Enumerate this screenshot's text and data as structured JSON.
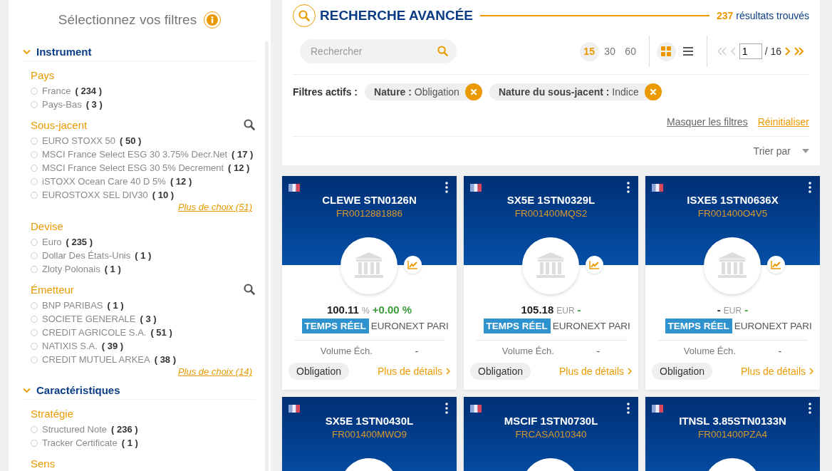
{
  "sidebar": {
    "title": "Sélectionnez vos filtres",
    "sections": [
      {
        "title": "Instrument",
        "expanded": true,
        "groups": [
          {
            "title": "Pays",
            "searchable": false,
            "options": [
              {
                "label": "France",
                "count": "( 234 )",
                "selected": false
              },
              {
                "label": "Pays-Bas",
                "count": "( 3 )",
                "selected": false
              }
            ]
          },
          {
            "title": "Sous-jacent",
            "searchable": true,
            "options": [
              {
                "label": "EURO STOXX 50",
                "count": "( 50 )",
                "selected": false
              },
              {
                "label": "MSCI France Select ESG 30 3.75% Decr.Net",
                "count": "( 17 )",
                "selected": false
              },
              {
                "label": "MSCI France Select ESG 30 5% Decrement",
                "count": "( 12 )",
                "selected": false
              },
              {
                "label": "iSTOXX Ocean Care 40 D 5%",
                "count": "( 12 )",
                "selected": false
              },
              {
                "label": "EUROSTOXX SEL DIV30",
                "count": "( 10 )",
                "selected": false
              }
            ],
            "more": "Plus de choix (51)"
          },
          {
            "title": "Devise",
            "searchable": false,
            "options": [
              {
                "label": "Euro",
                "count": "( 235 )",
                "selected": false
              },
              {
                "label": "Dollar Des États-Unis",
                "count": "( 1 )",
                "selected": false
              },
              {
                "label": "Zloty Polonais",
                "count": "( 1 )",
                "selected": false
              }
            ]
          },
          {
            "title": "Émetteur",
            "searchable": true,
            "options": [
              {
                "label": "BNP PARIBAS",
                "count": "( 1 )",
                "selected": false
              },
              {
                "label": "SOCIETE GENERALE",
                "count": "( 3 )",
                "selected": false
              },
              {
                "label": "CREDIT AGRICOLE S.A.",
                "count": "( 51 )",
                "selected": false
              },
              {
                "label": "NATIXIS S.A.",
                "count": "( 39 )",
                "selected": false
              },
              {
                "label": "CREDIT MUTUEL ARKEA",
                "count": "( 38 )",
                "selected": false
              }
            ],
            "more": "Plus de choix (14)"
          }
        ]
      },
      {
        "title": "Caractéristiques",
        "expanded": true,
        "groups": [
          {
            "title": "Stratégie",
            "searchable": false,
            "options": [
              {
                "label": "Structured Note",
                "count": "( 236 )",
                "selected": false
              },
              {
                "label": "Tracker Certificate",
                "count": "( 1 )",
                "selected": false
              }
            ]
          },
          {
            "title": "Sens",
            "searchable": false
          }
        ]
      }
    ]
  },
  "header": {
    "title": "RECHERCHE AVANCÉE",
    "result_count": "237",
    "result_label": "résultats trouvés"
  },
  "search": {
    "placeholder": "Rechercher"
  },
  "page_sizes": [
    {
      "label": "15",
      "selected": true
    },
    {
      "label": "30",
      "selected": false
    },
    {
      "label": "60",
      "selected": false
    }
  ],
  "views": [
    {
      "kind": "grid",
      "selected": true
    },
    {
      "kind": "list",
      "selected": false
    }
  ],
  "pagination": {
    "page": "1",
    "total": "/ 16"
  },
  "active_filters": {
    "label": "Filtres actifs :",
    "filters": [
      {
        "name": "Nature :",
        "value": "Obligation"
      },
      {
        "name": "Nature du sous-jacent :",
        "value": "Indice"
      }
    ]
  },
  "links": {
    "hide": "Masquer les filtres",
    "reset": "Réinitialiser"
  },
  "sort": {
    "label": "Trier par"
  },
  "cards": [
    {
      "title": "CLEWE STN0126N",
      "isin": "FR0012881886",
      "price": "100.11",
      "unit": "%",
      "change": "+0.00 %",
      "realtime": "TEMPS RÉEL",
      "market": "EURONEXT PARI",
      "volume_label": "Volume Éch.",
      "volume": "-",
      "tag": "Obligation",
      "details": "Plus de détails"
    },
    {
      "title": "SX5E 1STN0329L",
      "isin": "FR001400MQS2",
      "price": "105.18",
      "unit": "EUR",
      "change": "-",
      "realtime": "TEMPS RÉEL",
      "market": "EURONEXT PARI",
      "volume_label": "Volume Éch.",
      "volume": "-",
      "tag": "Obligation",
      "details": "Plus de détails"
    },
    {
      "title": "ISXE5 1STN0636X",
      "isin": "FR001400O4V5",
      "price": "-",
      "unit": "EUR",
      "change": "-",
      "realtime": "TEMPS RÉEL",
      "market": "EURONEXT PARI",
      "volume_label": "Volume Éch.",
      "volume": "-",
      "tag": "Obligation",
      "details": "Plus de détails"
    },
    {
      "title": "SX5E 1STN0430L",
      "isin": "FR001400MWO9"
    },
    {
      "title": "MSCIF 1STN0730L",
      "isin": "FRCASA010340"
    },
    {
      "title": "ITNSL 3.85STN0133N",
      "isin": "FR001400PZA4"
    }
  ]
}
